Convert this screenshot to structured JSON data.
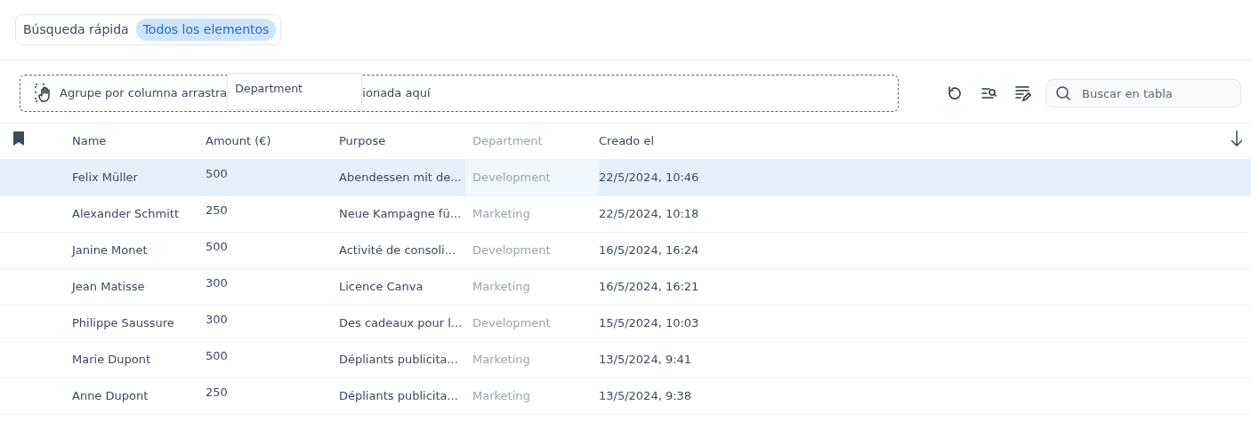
{
  "quick_search": {
    "label": "Búsqueda rápida",
    "chips": [
      {
        "label": "Todos los elementos",
        "selected": true
      }
    ]
  },
  "group_zone": {
    "text_before": "Agrupe por columna arrastra",
    "text_after": "ionada aquí",
    "dragged_column": "Department"
  },
  "search": {
    "placeholder": "Buscar en tabla"
  },
  "table": {
    "columns": [
      {
        "label": "Name",
        "dragging": false
      },
      {
        "label": "Amount (€)",
        "dragging": false
      },
      {
        "label": "Purpose",
        "dragging": false
      },
      {
        "label": "Department",
        "dragging": true
      },
      {
        "label": "Creado el",
        "dragging": false
      }
    ],
    "rows": [
      {
        "selected": true,
        "cells": [
          "Felix Müller",
          "500",
          "Abendessen mit de...",
          "Development",
          "22/5/2024, 10:46"
        ]
      },
      {
        "selected": false,
        "cells": [
          "Alexander Schmitt",
          "250",
          "Neue Kampagne fü...",
          "Marketing",
          "22/5/2024, 10:18"
        ]
      },
      {
        "selected": false,
        "cells": [
          "Janine Monet",
          "500",
          "Activité de consoli...",
          "Development",
          "16/5/2024, 16:24"
        ]
      },
      {
        "selected": false,
        "cells": [
          "Jean Matisse",
          "300",
          "Licence Canva",
          "Marketing",
          "16/5/2024, 16:21"
        ]
      },
      {
        "selected": false,
        "cells": [
          "Philippe Saussure",
          "300",
          "Des cadeaux pour l...",
          "Development",
          "15/5/2024, 10:03"
        ]
      },
      {
        "selected": false,
        "cells": [
          "Marie Dupont",
          "500",
          "Dépliants publicita...",
          "Marketing",
          "13/5/2024, 9:41"
        ]
      },
      {
        "selected": false,
        "cells": [
          "Anne Dupont",
          "250",
          "Dépliants publicita...",
          "Marketing",
          "13/5/2024, 9:38"
        ]
      }
    ]
  }
}
